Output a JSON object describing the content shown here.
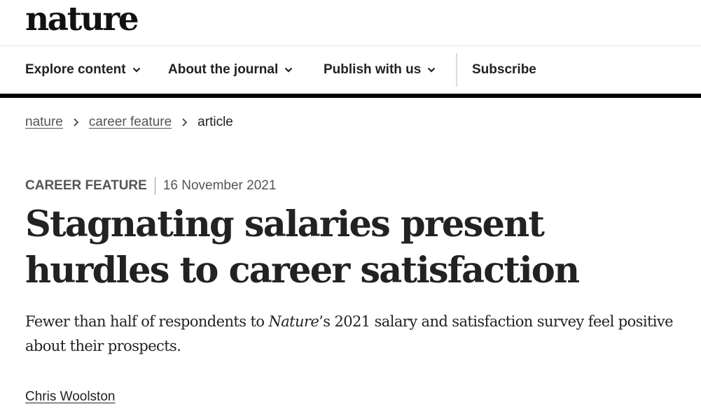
{
  "header": {
    "logo_text": "nature"
  },
  "nav": {
    "items": [
      {
        "label": "Explore content",
        "has_dropdown": true
      },
      {
        "label": "About the journal",
        "has_dropdown": true
      },
      {
        "label": "Publish with us",
        "has_dropdown": true
      },
      {
        "label": "Subscribe",
        "has_dropdown": false
      }
    ],
    "chevron_icon": "chevron-down-icon"
  },
  "breadcrumb": {
    "items": [
      "nature",
      "career feature",
      "article"
    ],
    "separator_icon": "chevron-right-icon"
  },
  "article": {
    "type": "CAREER FEATURE",
    "date": "16 November 2021",
    "title": "Stagnating salaries present hurdles to career satisfaction",
    "standfirst": {
      "before": "Fewer than half of respondents to ",
      "italic": "Nature",
      "after": "’s 2021 salary and satisfaction survey feel positive about their prospects."
    },
    "author": "Chris Woolston"
  },
  "colors": {
    "text": "#222222",
    "muted": "#555555",
    "rule": "#000000"
  }
}
